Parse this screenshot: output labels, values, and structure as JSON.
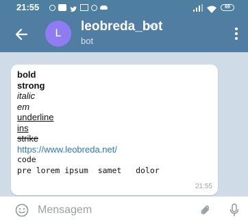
{
  "status_bar": {
    "time": "21:55",
    "battery": "69"
  },
  "header": {
    "title": "leobreda_bot",
    "subtitle": "bot",
    "avatar_letter": "L"
  },
  "message": {
    "lines": {
      "bold": "bold",
      "strong": "strong",
      "italic": "italic",
      "em": "em",
      "underline": "underline",
      "ins": "ins",
      "strike": "strike",
      "link": "https://www.leobreda.net/",
      "code": "code",
      "pre": "pre lorem ipsum  samet   dolor"
    },
    "time": "21:55"
  },
  "composer": {
    "placeholder": "Mensagem"
  },
  "colors": {
    "header": "#527da3",
    "status_bar": "#4e7ea0",
    "avatar": "#8f7cf2",
    "link": "#2d78b5",
    "chat_bg": "#cfdbe6"
  }
}
